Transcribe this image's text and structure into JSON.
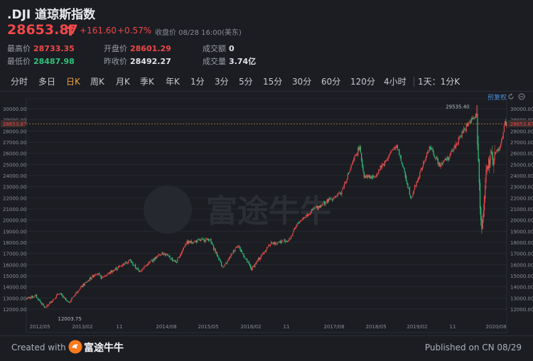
{
  "header": {
    "title": ".DJI 道琼斯指数",
    "price": "28653.87",
    "change": "+161.60",
    "change_pct": "+0.57%",
    "close_note": "收盘价  08/28 16:00(美东)",
    "stats": [
      {
        "label": "最高价",
        "value": "28733.35"
      },
      {
        "label": "开盘价",
        "value": "28601.29"
      },
      {
        "label": "成交额",
        "value": "0"
      },
      {
        "label": "最低价",
        "value": "28487.98"
      },
      {
        "label": "昨收价",
        "value": "28492.27"
      },
      {
        "label": "成交量",
        "value": "3.74亿"
      }
    ]
  },
  "tabs": [
    "分时",
    "多日",
    "日K",
    "周K",
    "月K",
    "季K",
    "年K",
    "1分",
    "3分",
    "5分",
    "15分",
    "30分",
    "60分",
    "120分",
    "4小时",
    "1天：1分K"
  ],
  "active_tab": "日K",
  "chart_tools": {
    "adjust_label": "前复权"
  },
  "colors": {
    "up": "#f04848",
    "down": "#2fc27a",
    "bg": "#1b1d23",
    "accent": "#f7a23a"
  },
  "icons": [
    "arrow-up-icon",
    "refresh-icon",
    "minus-circle-icon",
    "logo-icon"
  ],
  "chart_data": {
    "type": "candlestick",
    "title": "",
    "y_ticks": [
      12000,
      13000,
      14000,
      15000,
      16000,
      17000,
      18000,
      19000,
      20000,
      21000,
      22000,
      23000,
      24000,
      25000,
      26000,
      27000,
      28000,
      29000,
      30000
    ],
    "ylim": [
      11300,
      30500
    ],
    "x_ticks": [
      "2012/05",
      "2013/02",
      "11",
      "2014/08",
      "2015/05",
      "2016/02",
      "11",
      "2017/08",
      "2018/05",
      "2019/02",
      "11",
      "2020/08"
    ],
    "x_start": "2012/02",
    "x_end": "2020/08/28",
    "current_price_line": 28653.87,
    "annotations": [
      {
        "text": "29535.40",
        "value": 29535.4,
        "date": "2020/02"
      },
      {
        "text": "12003.75",
        "value": 12003.75,
        "date": "2012/06"
      }
    ],
    "series": [
      {
        "values": [
          [
            "2012/02",
            12950
          ],
          [
            "2012/04",
            13200
          ],
          [
            "2012/06",
            12100
          ],
          [
            "2012/09",
            13450
          ],
          [
            "2012/11",
            12550
          ],
          [
            "2013/01",
            13700
          ],
          [
            "2013/05",
            15300
          ],
          [
            "2013/06",
            14800
          ],
          [
            "2013/09",
            15600
          ],
          [
            "2013/12",
            16400
          ],
          [
            "2014/02",
            15400
          ],
          [
            "2014/07",
            17100
          ],
          [
            "2014/10",
            16200
          ],
          [
            "2014/12",
            17950
          ],
          [
            "2015/05",
            18300
          ],
          [
            "2015/08",
            15700
          ],
          [
            "2015/11",
            17800
          ],
          [
            "2016/02",
            15600
          ],
          [
            "2016/06",
            17900
          ],
          [
            "2016/10",
            18200
          ],
          [
            "2016/12",
            19800
          ],
          [
            "2017/03",
            20900
          ],
          [
            "2017/09",
            22400
          ],
          [
            "2018/01",
            26600
          ],
          [
            "2018/02",
            24000
          ],
          [
            "2018/04",
            23800
          ],
          [
            "2018/09",
            26800
          ],
          [
            "2018/12",
            22000
          ],
          [
            "2019/04",
            26600
          ],
          [
            "2019/06",
            25000
          ],
          [
            "2019/08",
            25600
          ],
          [
            "2019/12",
            28600
          ],
          [
            "2020/02",
            29400
          ],
          [
            "2020/03",
            18600
          ],
          [
            "2020/04",
            24400
          ],
          [
            "2020/06",
            26000
          ],
          [
            "2020/07",
            26500
          ],
          [
            "2020/08",
            28650
          ]
        ]
      }
    ]
  },
  "footer": {
    "created": "Created with",
    "brand": "富途牛牛",
    "published": "Published on CN 08/29",
    "watermark": "富途牛牛"
  }
}
